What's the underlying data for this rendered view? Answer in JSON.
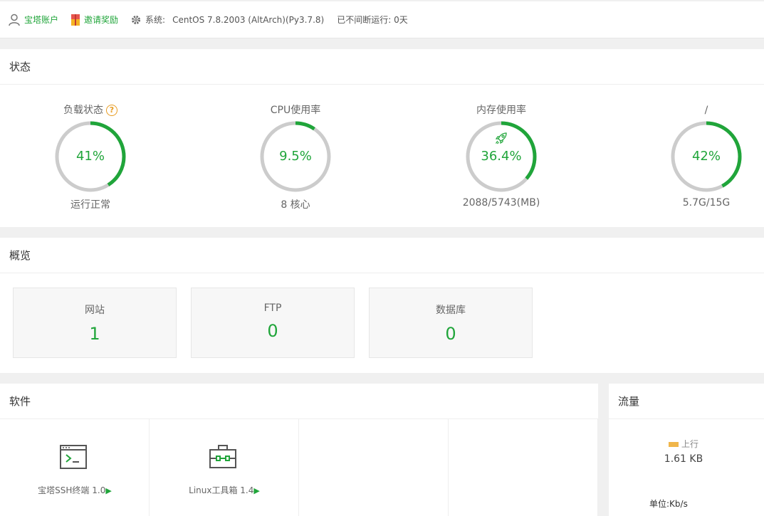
{
  "topbar": {
    "account": "宝塔账户",
    "invite": "邀请奖励",
    "system_label": "系统:",
    "system_value": "CentOS 7.8.2003 (AltArch)(Py3.7.8)",
    "uptime": "已不间断运行: 0天"
  },
  "status": {
    "title": "状态",
    "load": {
      "label": "负载状态",
      "help": "?",
      "value": "41%",
      "percent": 41,
      "sub": "运行正常"
    },
    "cpu": {
      "label": "CPU使用率",
      "value": "9.5%",
      "percent": 9.5,
      "sub": "8 核心"
    },
    "mem": {
      "label": "内存使用率",
      "value": "36.4%",
      "percent": 36.4,
      "sub": "2088/5743(MB)"
    },
    "disk": {
      "label": "/",
      "value": "42%",
      "percent": 42,
      "sub": "5.7G/15G"
    }
  },
  "overview": {
    "title": "概览",
    "site": {
      "label": "网站",
      "value": "1"
    },
    "ftp": {
      "label": "FTP",
      "value": "0"
    },
    "db": {
      "label": "数据库",
      "value": "0"
    }
  },
  "software": {
    "title": "软件",
    "items": [
      {
        "label": "宝塔SSH终端 1.0",
        "icon": "terminal-icon"
      },
      {
        "label": "Linux工具箱 1.4",
        "icon": "toolbox-icon"
      }
    ],
    "play": "▶"
  },
  "traffic": {
    "title": "流量",
    "legend": "上行",
    "value": "1.61 KB",
    "unit": "单位:Kb/s"
  },
  "colors": {
    "accent": "#20a53a",
    "ring_track": "#cccccc",
    "help_orange": "#e89c22",
    "legend_swatch": "#f0b64b"
  }
}
